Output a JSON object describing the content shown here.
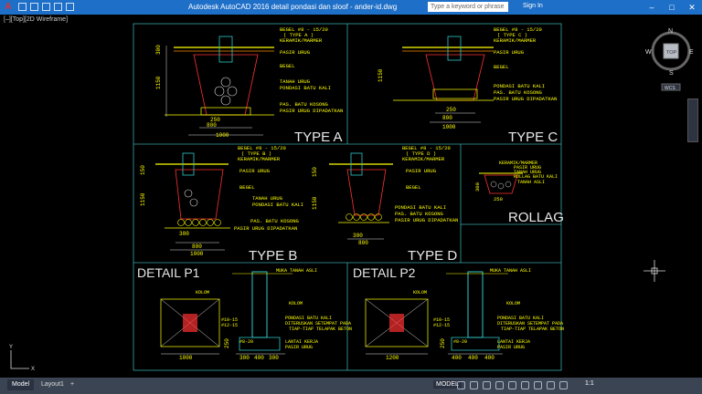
{
  "window": {
    "app_icon": "A",
    "title": "Autodesk AutoCAD 2016    detail pondasi dan sloof - ander-id.dwg",
    "search_placeholder": "Type a keyword or phrase",
    "signin_label": "Sign In",
    "minimize": "–",
    "maximize": "□",
    "close": "✕"
  },
  "viewport": {
    "label": "[–][Top][2D Wireframe]"
  },
  "viewcube": {
    "n": "N",
    "s": "S",
    "e": "E",
    "w": "W",
    "face": "TOP",
    "wcs": "WCS"
  },
  "drawing": {
    "type_a": {
      "title": "TYPE A",
      "notes": [
        "BEGEL #8 - 15/20",
        "( TYPE A )",
        "KERAMIK/MARMER",
        "PASIR URUG",
        "BEGEL",
        "TANAH URUG",
        "PONDASI BATU KALI",
        "PAS. BATU KOSONG",
        "PASIR URUG DIPADATKAN"
      ],
      "dims": [
        "800",
        "1000",
        "250",
        "300",
        "150",
        "1150",
        "600",
        "250"
      ]
    },
    "type_c": {
      "title": "TYPE C",
      "notes": [
        "BEGEL #8 - 15/20",
        "( TYPE C )",
        "KERAMIK/MARMER",
        "PASIR URUG",
        "BEGEL",
        "PONDASI BATU KALI",
        "PAS. BATU KOSONG",
        "PASIR URUG DIPADATKAN"
      ],
      "dims": [
        "250",
        "800",
        "1000",
        "300",
        "150",
        "1150",
        "600"
      ]
    },
    "type_b": {
      "title": "TYPE B",
      "notes": [
        "BEGEL #8 - 15/20",
        "( TYPE B )",
        "KERAMIK/MARMER",
        "PASIR URUG",
        "BEGEL",
        "TANAH URUG",
        "PONDASI BATU KALI",
        "PAS. BATU KOSONG",
        "PASIR URUG DIPADATKAN"
      ],
      "dims": [
        "300",
        "800",
        "1000",
        "150",
        "1150",
        "600"
      ]
    },
    "type_d": {
      "title": "TYPE D",
      "notes": [
        "BEGEL #8 - 15/20",
        "( TYPE D )",
        "KERAMIK/MARMER",
        "PASIR URUG",
        "BEGEL",
        "PONDASI BATU KALI",
        "PAS. BATU KOSONG",
        "PASIR URUG DIPADATKAN"
      ],
      "dims": [
        "300",
        "800",
        "150",
        "1150",
        "600"
      ]
    },
    "rollag": {
      "title": "ROLLAG",
      "notes": [
        "KERAMIK/MARMER",
        "PASIR URUG",
        "TANAH URUG",
        "ROLLAG BATU KALI",
        "TANAH ASLI"
      ],
      "dims": [
        "300",
        "250"
      ]
    },
    "detail_p1": {
      "title": "DETAIL  P1",
      "notes": [
        "KOLOM",
        "MUKA TANAH ASLI",
        "KOLOM",
        "PONDASI BATU KALI",
        "DITERUSKAN SETEMPAT PADA",
        "TIAP-TIAP TELAPAK BETON",
        "LANTAI KERJA",
        "PASIR URUG"
      ],
      "rebar": [
        "#10-15",
        "#12-15",
        "#8-20"
      ],
      "dims": [
        "1000",
        "300",
        "400",
        "300",
        "250"
      ]
    },
    "detail_p2": {
      "title": "DETAIL  P2",
      "notes": [
        "KOLOM",
        "MUKA TANAH ASLI",
        "KOLOM",
        "PONDASI BATU KALI",
        "DITERUSKAN SETEMPAT PADA",
        "TIAP-TIAP TELAPAK BETON",
        "LANTAI KERJA",
        "PASIR URUG"
      ],
      "rebar": [
        "#10-15",
        "#12-15",
        "#8-20"
      ],
      "dims": [
        "1200",
        "400",
        "400",
        "400",
        "250"
      ]
    }
  },
  "status": {
    "tabs": [
      "Model",
      "Layout1",
      "+"
    ],
    "model_label": "MODEL",
    "scale": "1:1"
  },
  "colors": {
    "titlebar": "#1e6fc8",
    "background": "#000000",
    "frame": "#3aa6a6",
    "title_text": "#e8e8e8",
    "note_text": "#ffff00",
    "red": "#ff3030",
    "cyan": "#30c8c8"
  }
}
